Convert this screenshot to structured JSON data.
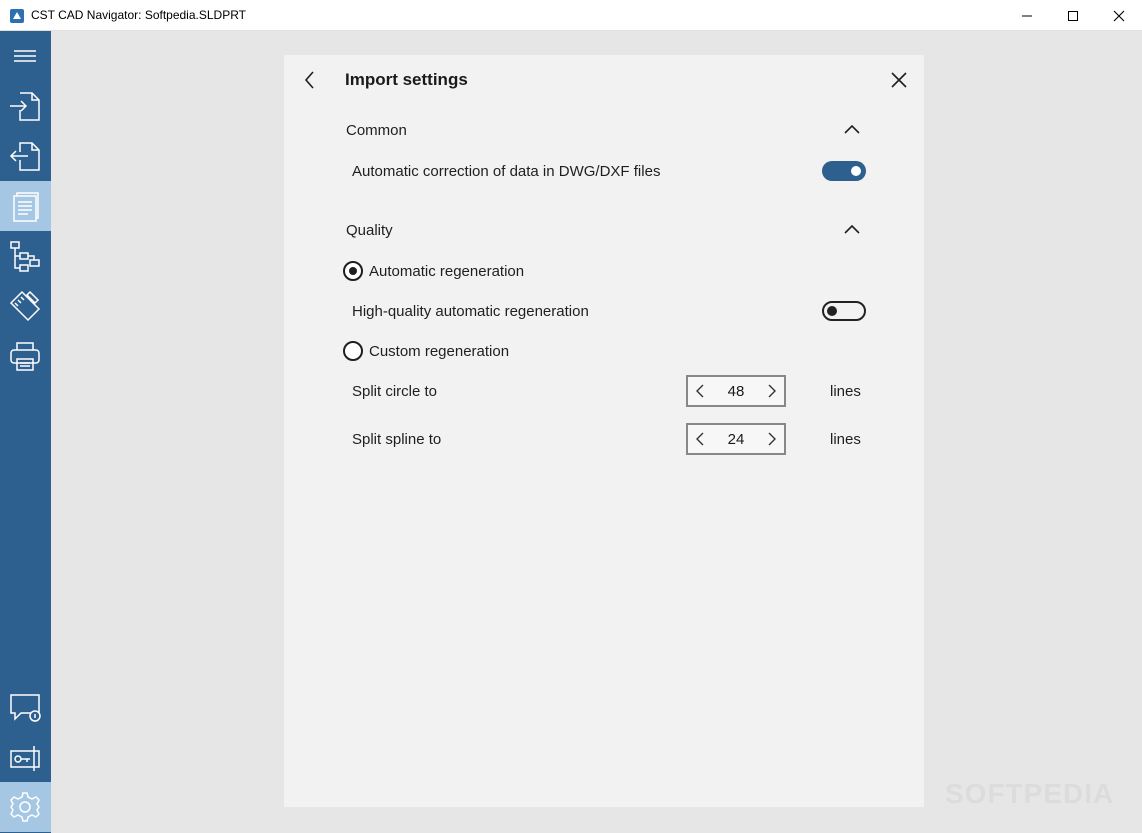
{
  "window": {
    "title": "CST CAD Navigator: Softpedia.SLDPRT"
  },
  "sidebar": {
    "items": [
      {
        "icon": "menu-icon"
      },
      {
        "icon": "import-file-icon"
      },
      {
        "icon": "export-file-icon"
      },
      {
        "icon": "document-pages-icon",
        "active": true
      },
      {
        "icon": "hierarchy-tree-icon"
      },
      {
        "icon": "drawing-tools-icon"
      },
      {
        "icon": "printer-icon"
      },
      {
        "icon": "feedback-chat-icon"
      },
      {
        "icon": "license-key-icon"
      },
      {
        "icon": "settings-gear-icon",
        "active": true
      }
    ]
  },
  "dialog": {
    "title": "Import settings",
    "common": {
      "header": "Common",
      "auto_correction_label": "Automatic correction of data in DWG/DXF files",
      "auto_correction_on": true
    },
    "quality": {
      "header": "Quality",
      "auto_regen_label": "Automatic regeneration",
      "auto_regen_selected": true,
      "hq_regen_label": "High-quality automatic regeneration",
      "hq_regen_on": false,
      "custom_regen_label": "Custom regeneration",
      "custom_regen_selected": false,
      "split_circle_label": "Split circle to",
      "split_circle_value": "48",
      "split_spline_label": "Split spline to",
      "split_spline_value": "24",
      "unit_label": "lines"
    }
  },
  "watermark": "SOFTPEDIA",
  "colors": {
    "accent": "#2d5f8f",
    "sidebar_active": "#a5c7e3",
    "panel_bg": "#f2f2f2",
    "workspace_bg": "#e6e6e6"
  }
}
